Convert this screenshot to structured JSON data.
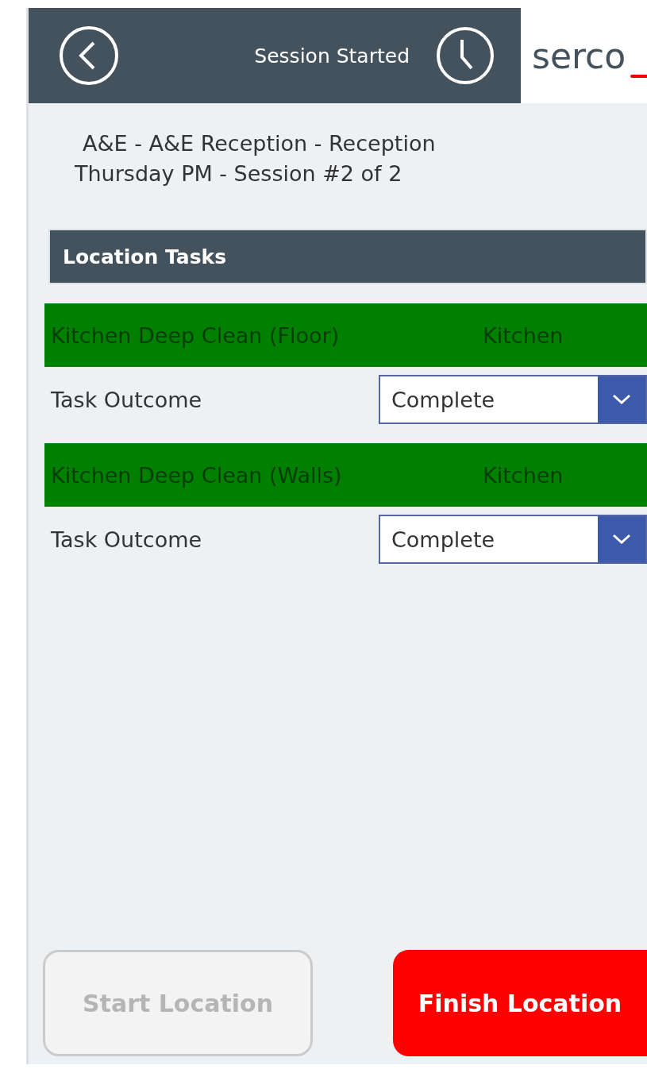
{
  "header": {
    "title": "Session Started",
    "logo": "serco"
  },
  "location": {
    "line_1": "A&E - A&E Reception - Reception",
    "line_2": "Thursday PM - Session #2 of 2"
  },
  "section": {
    "title": "Location Tasks"
  },
  "tasks": [
    {
      "name": "Kitchen Deep Clean (Floor)",
      "area": "Kitchen",
      "color": "#008000",
      "outcome_label": "Task Outcome",
      "outcome": "Complete"
    },
    {
      "name": "Kitchen Deep Clean (Walls)",
      "area": "Kitchen",
      "color": "#008000",
      "outcome_label": "Task Outcome",
      "outcome": "Complete"
    }
  ],
  "buttons": [
    {
      "label": "Start Location",
      "kind": "secondary",
      "disabled": true
    },
    {
      "label": "Finish Location",
      "kind": "primary",
      "disabled": false
    }
  ]
}
